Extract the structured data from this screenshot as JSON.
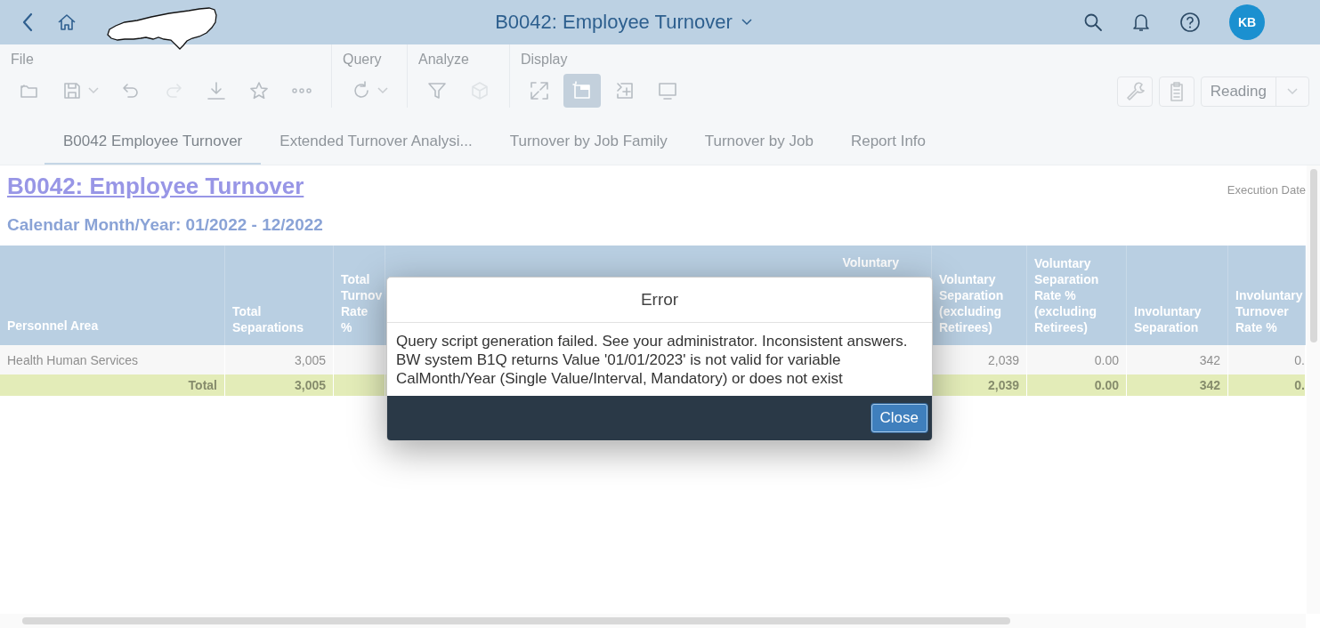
{
  "header": {
    "title": "B0042: Employee Turnover",
    "avatar": "KB"
  },
  "toolbar": {
    "groups": [
      {
        "label": "File",
        "items": [
          {
            "kind": "folder",
            "menu": false,
            "disabled": false,
            "selected": false
          },
          {
            "kind": "save",
            "menu": true,
            "disabled": false,
            "selected": false
          },
          {
            "kind": "undo",
            "menu": false,
            "disabled": false,
            "selected": false
          },
          {
            "kind": "redo",
            "menu": false,
            "disabled": true,
            "selected": false
          },
          {
            "kind": "download",
            "menu": false,
            "disabled": false,
            "selected": false
          },
          {
            "kind": "star",
            "menu": false,
            "disabled": false,
            "selected": false
          },
          {
            "kind": "more",
            "menu": false,
            "disabled": false,
            "selected": false
          }
        ]
      },
      {
        "label": "Query",
        "items": [
          {
            "kind": "refresh",
            "menu": true,
            "disabled": false,
            "selected": false
          }
        ]
      },
      {
        "label": "Analyze",
        "items": [
          {
            "kind": "filter",
            "menu": false,
            "disabled": false,
            "selected": false
          },
          {
            "kind": "cube",
            "menu": false,
            "disabled": true,
            "selected": false
          }
        ]
      },
      {
        "label": "Display",
        "items": [
          {
            "kind": "expand",
            "menu": false,
            "disabled": false,
            "selected": false
          },
          {
            "kind": "panel",
            "menu": false,
            "disabled": false,
            "selected": true
          },
          {
            "kind": "add-column",
            "menu": false,
            "disabled": false,
            "selected": false
          },
          {
            "kind": "monitor",
            "menu": false,
            "disabled": false,
            "selected": false
          }
        ]
      }
    ],
    "tools": [
      {
        "kind": "wrench"
      },
      {
        "kind": "clipboard"
      }
    ],
    "view_select": "Reading"
  },
  "tabs": [
    {
      "label": "B0042 Employee Turnover",
      "selected": true
    },
    {
      "label": "Extended Turnover Analysi...",
      "selected": false
    },
    {
      "label": "Turnover by Job Family",
      "selected": false
    },
    {
      "label": "Turnover by Job",
      "selected": false
    },
    {
      "label": "Report Info",
      "selected": false
    }
  ],
  "report": {
    "title": "B0042: Employee Turnover",
    "execution_label": "Execution Date",
    "period": "Calendar Month/Year:  01/2022 - 12/2022"
  },
  "table": {
    "columns": [
      "Personnel Area",
      "Total Separations",
      "Total Turnov Rate %",
      "Voluntary",
      "Voluntary Separation (excluding Retirees)",
      "Voluntary Separation Rate % (excluding Retirees)",
      "Involuntary Separation",
      "Involuntary Turnover Rate %"
    ],
    "rows": [
      {
        "kind": "data",
        "cells": [
          "Health Human Services",
          "3,005",
          null,
          null,
          "2,039",
          "0.00",
          "342",
          "0."
        ]
      },
      {
        "kind": "total",
        "cells": [
          "Total",
          "3,005",
          null,
          null,
          "2,039",
          "0.00",
          "342",
          "0."
        ]
      }
    ]
  },
  "dialog": {
    "title": "Error",
    "message": "Query script generation failed. See your administrator. Inconsistent answers. BW system B1Q returns Value '01/01/2023' is not valid for variable CalMonth/Year (Single Value/Interval, Mandatory) or does not exist",
    "buttons": [
      "Close"
    ]
  }
}
